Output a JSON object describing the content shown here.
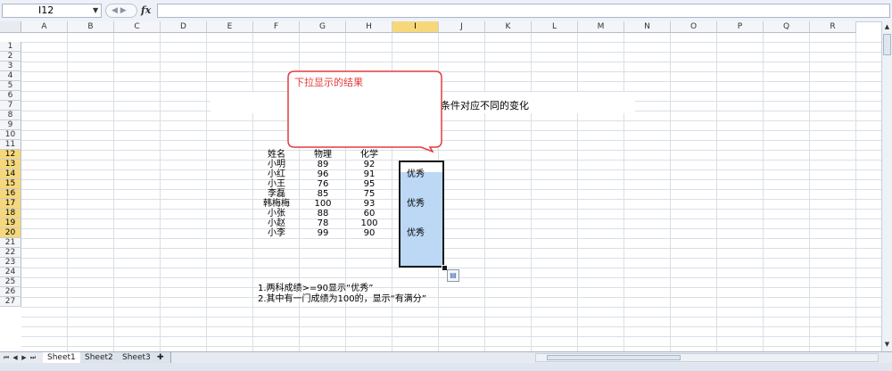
{
  "formula_bar": {
    "name_box": "I12",
    "fx_label": "fx",
    "formula": ""
  },
  "columns": [
    "A",
    "B",
    "C",
    "D",
    "E",
    "F",
    "G",
    "H",
    "I",
    "J",
    "K",
    "L",
    "M",
    "N",
    "O",
    "P",
    "Q",
    "R"
  ],
  "rows": [
    "1",
    "2",
    "3",
    "4",
    "5",
    "6",
    "7",
    "8",
    "9",
    "10",
    "11",
    "12",
    "13",
    "14",
    "15",
    "16",
    "17",
    "18",
    "19",
    "20",
    "21",
    "22",
    "23",
    "24",
    "25",
    "26",
    "27"
  ],
  "selected": {
    "column": "I",
    "rows": [
      "12",
      "13",
      "14",
      "15",
      "16",
      "17",
      "18",
      "19",
      "20"
    ]
  },
  "callout": {
    "text": "下拉显示的结果",
    "color": "#e53a3a"
  },
  "caption": "条件对应不同的变化",
  "table": {
    "headers": [
      "姓名",
      "物理",
      "化学"
    ],
    "rows": [
      [
        "小明",
        "89",
        "92",
        ""
      ],
      [
        "小红",
        "96",
        "91",
        "优秀"
      ],
      [
        "小王",
        "76",
        "95",
        ""
      ],
      [
        "李磊",
        "85",
        "75",
        ""
      ],
      [
        "韩梅梅",
        "100",
        "93",
        "优秀"
      ],
      [
        "小张",
        "88",
        "60",
        ""
      ],
      [
        "小赵",
        "78",
        "100",
        ""
      ],
      [
        "小李",
        "99",
        "90",
        "优秀"
      ]
    ]
  },
  "notes": [
    "1.两科成绩>=90显示“优秀”",
    "2.其中有一门成绩为100的，显示“有满分”"
  ],
  "sheets": [
    "Sheet1",
    "Sheet2",
    "Sheet3"
  ],
  "colors": {
    "selection_fill": "#bcd8f5",
    "selection_border": "#1a1a1a",
    "header_highlight": "#f6d87a"
  }
}
